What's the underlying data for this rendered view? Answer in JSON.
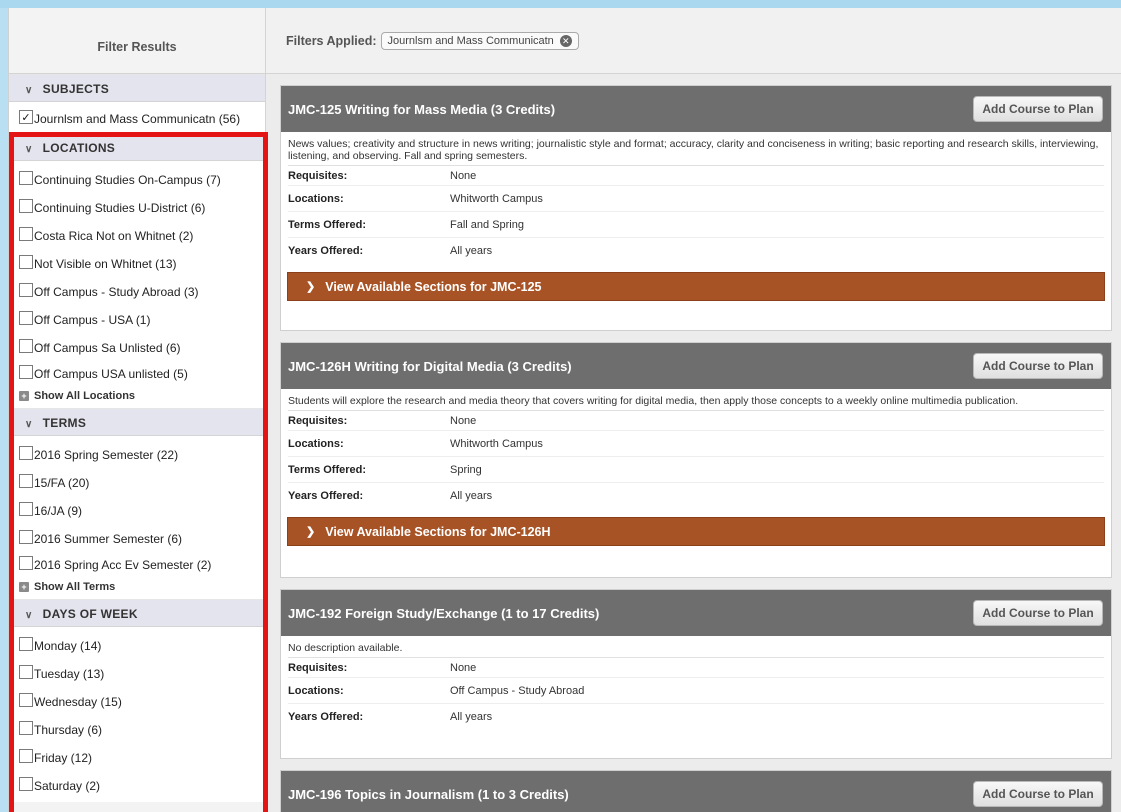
{
  "sidebar": {
    "title": "Filter Results",
    "sections": [
      {
        "heading": "SUBJECTS",
        "items": [
          {
            "label": "Journlsm and Mass Communicatn (56)",
            "checked": true
          }
        ]
      },
      {
        "heading": "LOCATIONS",
        "items": [
          {
            "label": "Continuing Studies On-Campus (7)",
            "checked": false
          },
          {
            "label": "Continuing Studies U-District (6)",
            "checked": false
          },
          {
            "label": "Costa Rica Not on Whitnet (2)",
            "checked": false
          },
          {
            "label": "Not Visible on Whitnet (13)",
            "checked": false
          },
          {
            "label": "Off Campus - Study Abroad (3)",
            "checked": false
          },
          {
            "label": "Off Campus - USA (1)",
            "checked": false
          },
          {
            "label": "Off Campus Sa Unlisted (6)",
            "checked": false
          },
          {
            "label": "Off Campus USA unlisted (5)",
            "checked": false
          }
        ],
        "show_all": "Show All Locations"
      },
      {
        "heading": "TERMS",
        "items": [
          {
            "label": "2016 Spring Semester (22)",
            "checked": false
          },
          {
            "label": "15/FA (20)",
            "checked": false
          },
          {
            "label": "16/JA (9)",
            "checked": false
          },
          {
            "label": "2016 Summer Semester (6)",
            "checked": false
          },
          {
            "label": "2016 Spring Acc Ev Semester (2)",
            "checked": false
          }
        ],
        "show_all": "Show All Terms"
      },
      {
        "heading": "DAYS OF WEEK",
        "items": [
          {
            "label": "Monday (14)",
            "checked": false
          },
          {
            "label": "Tuesday (13)",
            "checked": false
          },
          {
            "label": "Wednesday (15)",
            "checked": false
          },
          {
            "label": "Thursday (6)",
            "checked": false
          },
          {
            "label": "Friday (12)",
            "checked": false
          },
          {
            "label": "Saturday (2)",
            "checked": false
          }
        ]
      }
    ]
  },
  "filters": {
    "label": "Filters Applied:",
    "chip": "Journlsm and Mass Communicatn",
    "remove_icon": "close-circle-icon"
  },
  "courses": [
    {
      "title": "JMC-125 Writing for Mass Media (3 Credits)",
      "add_label": "Add Course to Plan",
      "description": "News values; creativity and structure in news writing; journalistic style and format; accuracy, clarity and conciseness in writing; basic reporting and research skills, interviewing, listening, and observing. Fall and spring semesters.",
      "rows": [
        {
          "k": "Requisites:",
          "v": "None"
        },
        {
          "k": "Locations:",
          "v": "Whitworth Campus"
        },
        {
          "k": "Terms Offered:",
          "v": "Fall and Spring"
        },
        {
          "k": "Years Offered:",
          "v": "All years"
        }
      ],
      "sections_label": "View Available Sections for JMC-125"
    },
    {
      "title": "JMC-126H Writing for Digital Media (3 Credits)",
      "add_label": "Add Course to Plan",
      "description": "Students will explore the research and media theory that covers writing for digital media, then apply those concepts to a weekly online multimedia publication.",
      "rows": [
        {
          "k": "Requisites:",
          "v": "None"
        },
        {
          "k": "Locations:",
          "v": "Whitworth Campus"
        },
        {
          "k": "Terms Offered:",
          "v": "Spring"
        },
        {
          "k": "Years Offered:",
          "v": "All years"
        }
      ],
      "sections_label": "View Available Sections for JMC-126H"
    },
    {
      "title": "JMC-192 Foreign Study/Exchange (1 to 17 Credits)",
      "add_label": "Add Course to Plan",
      "description": "No description available.",
      "rows": [
        {
          "k": "Requisites:",
          "v": "None"
        },
        {
          "k": "Locations:",
          "v": "Off Campus - Study Abroad"
        },
        {
          "k": "Years Offered:",
          "v": "All years"
        }
      ]
    },
    {
      "title": "JMC-196 Topics in Journalism (1 to 3 Credits)",
      "add_label": "Add Course to Plan"
    }
  ],
  "colors": {
    "course_header": "#6e6e6e",
    "sections_bar": "#a85326",
    "highlight_box": "#e51414"
  }
}
